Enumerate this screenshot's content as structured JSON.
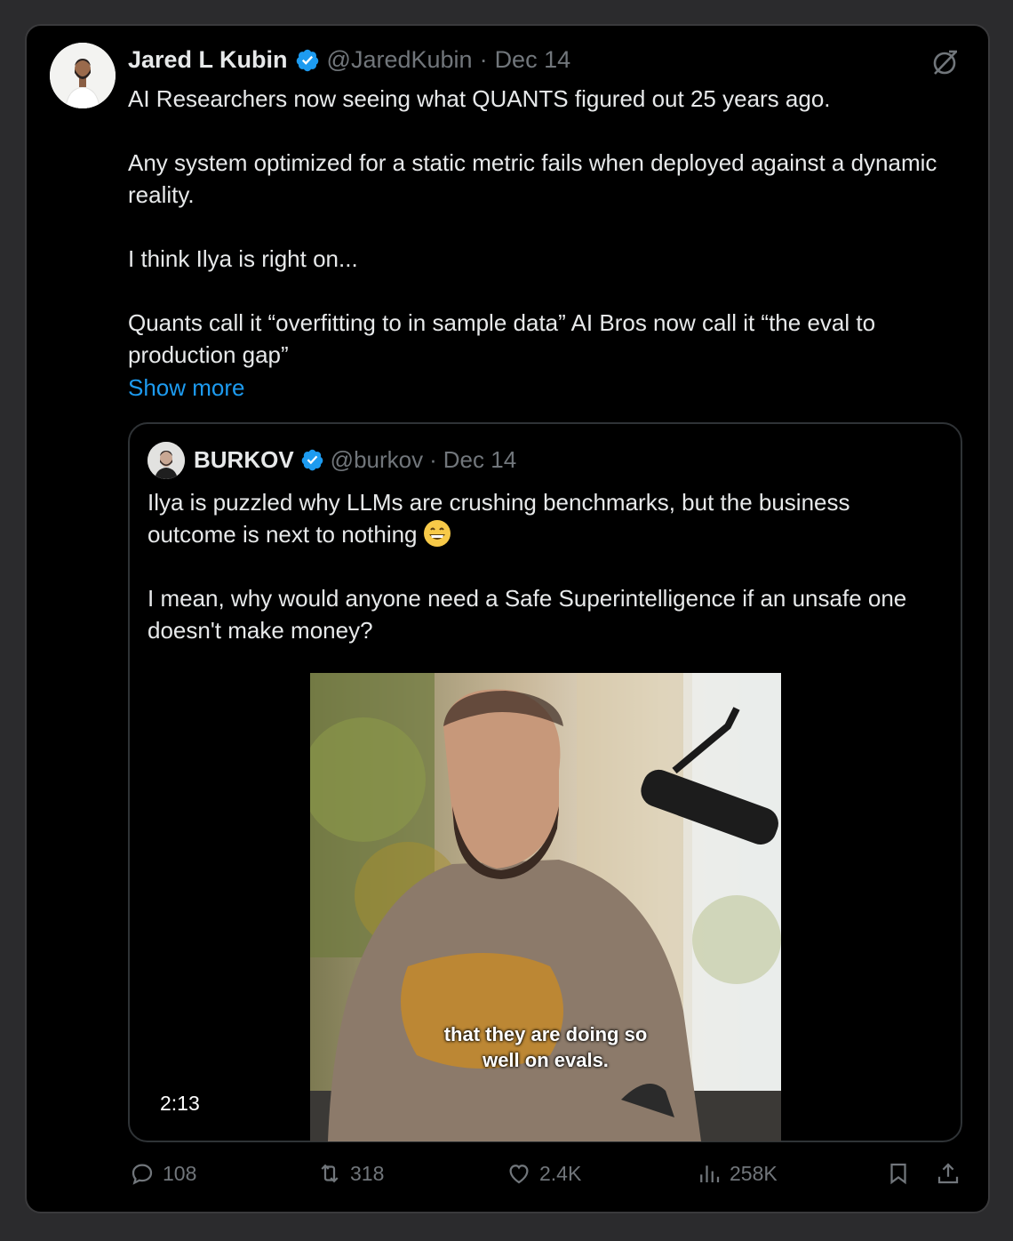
{
  "tweet": {
    "author_name": "Jared L Kubin",
    "handle": "@JaredKubin",
    "separator": "·",
    "date": "Dec 14",
    "paragraphs": [
      "AI Researchers now seeing what QUANTS figured out 25 years ago.",
      "Any system optimized for a static metric fails when deployed against a dynamic reality.",
      "I think Ilya is right on...",
      "Quants call it “overfitting to in sample data” AI Bros now call it “the eval to production gap”"
    ],
    "show_more": "Show more"
  },
  "quote": {
    "author_name": "BURKOV",
    "handle": "@burkov",
    "separator": "·",
    "date": "Dec 14",
    "paragraph_1": "Ilya is puzzled why LLMs are crushing benchmarks, but the business outcome is next to nothing",
    "paragraph_2": "I mean, why would anyone need a Safe Superintelligence if an unsafe one doesn't make money?",
    "video": {
      "caption_line_1": "that they are doing so",
      "caption_line_2": "well on evals.",
      "duration": "2:13"
    }
  },
  "actions": {
    "replies": "108",
    "reposts": "318",
    "likes": "2.4K",
    "views": "258K"
  },
  "colors": {
    "background": "#000000",
    "accent": "#1d9bf0",
    "muted": "#71767b",
    "text": "#e7e9ea"
  },
  "icons": [
    "verified-badge-icon",
    "grok-icon",
    "reply-icon",
    "repost-icon",
    "like-icon",
    "views-icon",
    "bookmark-icon",
    "share-icon",
    "grinning-emoji-icon"
  ]
}
